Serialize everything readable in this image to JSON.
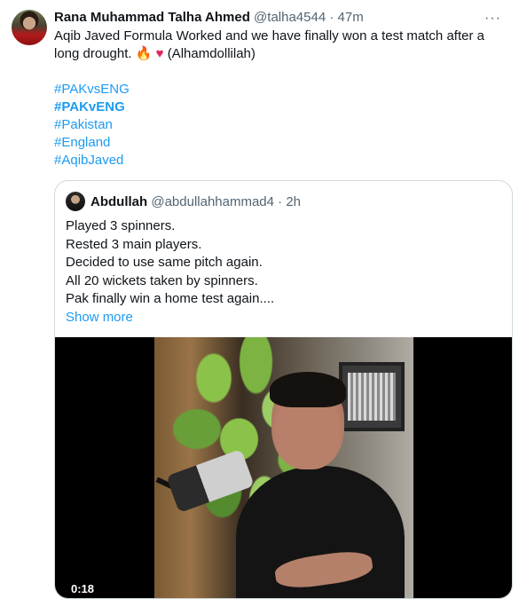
{
  "tweet": {
    "author_name": "Rana Muhammad Talha Ahmed",
    "author_handle": "@talha4544",
    "separator": "·",
    "time": "47m",
    "more_icon_glyph": "···",
    "text_line1": "Aqib Javed Formula Worked and we have finally won a test match after a",
    "text_line2_prefix": "long drought.",
    "text_line2_suffix": "(Alhamdollilah)",
    "emoji_flame": "🔥",
    "emoji_heart": "♥",
    "hashtags": [
      "#PAKvsENG",
      "#PAKvENG",
      "#Pakistan",
      "#England",
      "#AqibJaved"
    ]
  },
  "quote": {
    "author_name": "Abdullah",
    "author_handle": "@abdullahhammad4",
    "separator": "·",
    "time": "2h",
    "lines": [
      "Played 3 spinners.",
      "Rested 3 main players.",
      "Decided to use same pitch again.",
      "All 20 wickets taken by spinners.",
      "Pak finally win a home test again...."
    ],
    "show_more": "Show more",
    "video_duration": "0:18"
  },
  "colors": {
    "accent": "#1d9bf0",
    "secondary_text": "#536471",
    "border": "#cfd9de"
  },
  "icons": [
    "more-icon"
  ]
}
